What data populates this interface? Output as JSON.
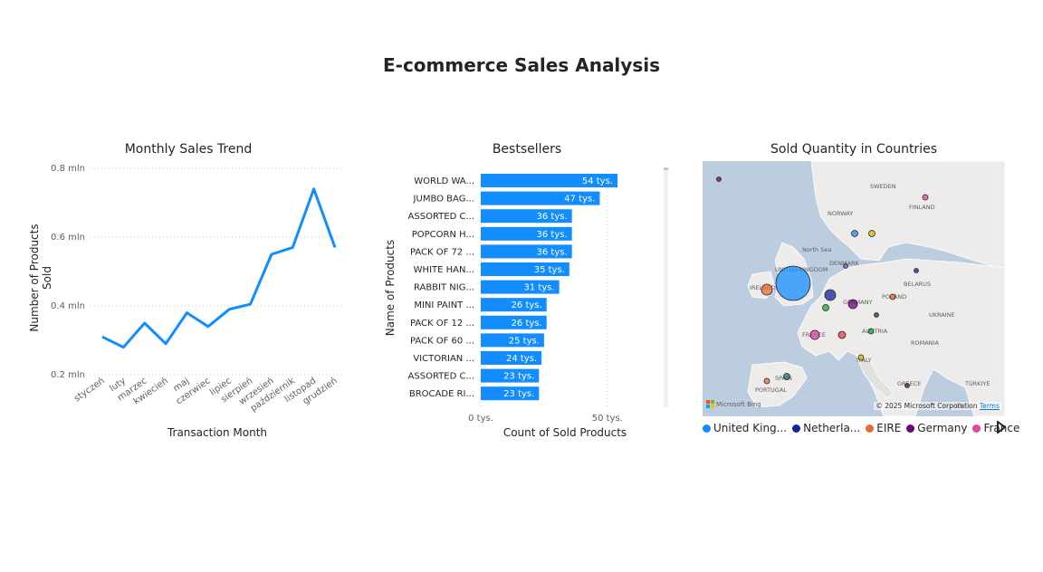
{
  "page": {
    "title": "E-commerce Sales Analysis"
  },
  "line_visual": {
    "title": "Monthly Sales Trend",
    "xlabel": "Transaction Month",
    "ylabel": "Number of Products Sold",
    "y_ticks": [
      "0.8 mln",
      "0.6 mln",
      "0.4 mln",
      "0.2 mln"
    ]
  },
  "bar_visual": {
    "title": "Bestsellers",
    "xlabel": "Count of Sold Products",
    "ylabel": "Name of Products",
    "x_ticks": [
      "0 tys.",
      "50 tys."
    ]
  },
  "map_visual": {
    "title": "Sold Quantity in Countries",
    "copyright": "© 2025 Microsoft Corporation",
    "terms": "Terms",
    "bing": "Microsoft Bing",
    "place_labels": [
      "SWEDEN",
      "FINLAND",
      "NORWAY",
      "North Sea",
      "DENMARK",
      "UNITED KINGDOM",
      "IRELAND",
      "BELARUS",
      "POLAND",
      "GERMANY",
      "UKRAINE",
      "FRANCE",
      "AUSTRIA",
      "ROMANIA",
      "ITALY",
      "SPAIN",
      "PORTUGAL",
      "GREECE",
      "TÜRKIYE"
    ],
    "legend": [
      {
        "label": "United King...",
        "color": "#118dff"
      },
      {
        "label": "Netherla...",
        "color": "#12239e"
      },
      {
        "label": "EIRE",
        "color": "#e66c37"
      },
      {
        "label": "Germany",
        "color": "#6b007b"
      },
      {
        "label": "France",
        "color": "#e044a7"
      }
    ]
  },
  "colors": {
    "accent": "#118dff",
    "text": "#252423",
    "muted": "#605e5c"
  },
  "chart_data": [
    {
      "type": "line",
      "title": "Monthly Sales Trend",
      "xlabel": "Transaction Month",
      "ylabel": "Number of Products Sold",
      "categories": [
        "styczeń",
        "luty",
        "marzec",
        "kwiecień",
        "maj",
        "czerwiec",
        "lipiec",
        "sierpień",
        "wrzesień",
        "październik",
        "listopad",
        "grudzień"
      ],
      "values": [
        0.31,
        0.28,
        0.35,
        0.29,
        0.38,
        0.34,
        0.39,
        0.405,
        0.55,
        0.57,
        0.74,
        0.57
      ],
      "ylim": [
        0.2,
        0.8
      ],
      "unit": "mln",
      "grid": true
    },
    {
      "type": "bar",
      "orientation": "horizontal",
      "title": "Bestsellers",
      "xlabel": "Count of Sold Products",
      "ylabel": "Name of Products",
      "categories": [
        "WORLD WA...",
        "JUMBO BAG...",
        "ASSORTED C...",
        "POPCORN H...",
        "PACK OF 72 ...",
        "WHITE HAN...",
        "RABBIT NIG...",
        "MINI PAINT ...",
        "PACK OF 12 ...",
        "PACK OF 60 ...",
        "VICTORIAN ...",
        "ASSORTED C...",
        "BROCADE RI..."
      ],
      "values": [
        54,
        47,
        36,
        36,
        36,
        35,
        31,
        26,
        26,
        25,
        24,
        23,
        23
      ],
      "data_labels": [
        "54 tys.",
        "47 tys.",
        "36 tys.",
        "36 tys.",
        "36 tys.",
        "35 tys.",
        "31 tys.",
        "26 tys.",
        "26 tys.",
        "25 tys.",
        "24 tys.",
        "23 tys.",
        "23 tys."
      ],
      "xlim": [
        0,
        54
      ],
      "unit": "tys."
    }
  ]
}
